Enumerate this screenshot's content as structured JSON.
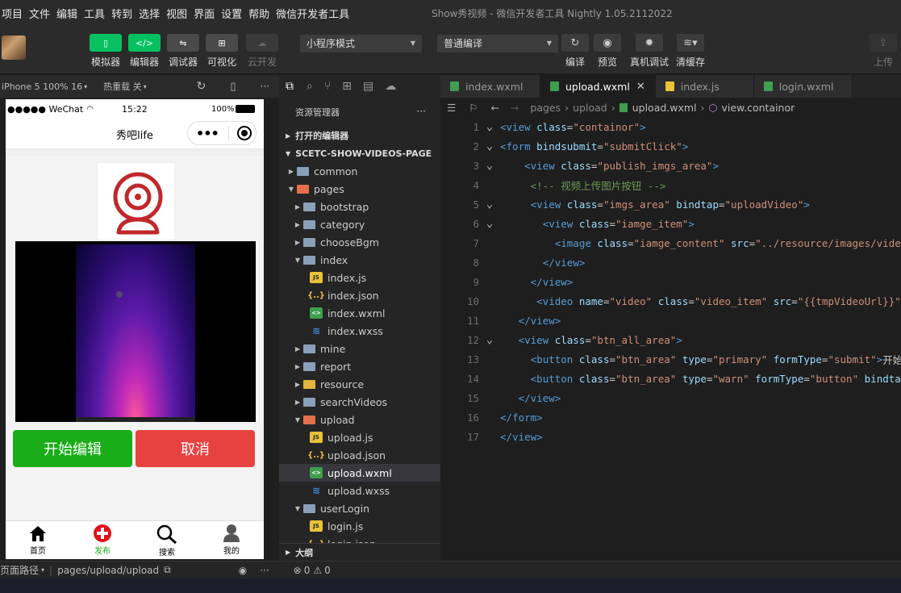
{
  "menu": [
    "项目",
    "文件",
    "编辑",
    "工具",
    "转到",
    "选择",
    "视图",
    "界面",
    "设置",
    "帮助",
    "微信开发者工具"
  ],
  "window_title": "Show秀视频 - 微信开发者工具 Nightly 1.05.2112022",
  "toolbar": {
    "simulator": "模拟器",
    "editor": "编辑器",
    "debugger": "调试器",
    "visual": "可视化",
    "cloud": "云开发",
    "mode_select": "小程序模式",
    "compile_select": "普通编译",
    "compile": "编译",
    "preview": "预览",
    "real_debug": "真机调试",
    "clear_cache": "清缓存",
    "upload": "上传"
  },
  "simulator": {
    "device": "iPhone 5 100% 16",
    "hot_reload": "热重载 关",
    "status_carrier": "●●●●● WeChat",
    "status_time": "15:22",
    "status_battery": "100%",
    "nav_title": "秀吧life",
    "btn_start": "开始编辑",
    "btn_cancel": "取消",
    "tabs": [
      "首页",
      "发布",
      "搜索",
      "我的"
    ]
  },
  "explorer": {
    "title": "资源管理器",
    "open_editors": "打开的编辑器",
    "project": "SCETC-SHOW-VIDEOS-PAGE",
    "outline": "大纲",
    "tree": [
      {
        "name": "common",
        "type": "folder",
        "depth": 1,
        "open": false
      },
      {
        "name": "pages",
        "type": "folder-red",
        "depth": 1,
        "open": true
      },
      {
        "name": "bootstrap",
        "type": "folder",
        "depth": 2,
        "open": false
      },
      {
        "name": "category",
        "type": "folder",
        "depth": 2,
        "open": false
      },
      {
        "name": "chooseBgm",
        "type": "folder",
        "depth": 2,
        "open": false
      },
      {
        "name": "index",
        "type": "folder",
        "depth": 2,
        "open": true
      },
      {
        "name": "index.js",
        "type": "js",
        "depth": 3
      },
      {
        "name": "index.json",
        "type": "json",
        "depth": 3
      },
      {
        "name": "index.wxml",
        "type": "wxml",
        "depth": 3
      },
      {
        "name": "index.wxss",
        "type": "wxss",
        "depth": 3
      },
      {
        "name": "mine",
        "type": "folder",
        "depth": 2,
        "open": false
      },
      {
        "name": "report",
        "type": "folder",
        "depth": 2,
        "open": false
      },
      {
        "name": "resource",
        "type": "folder-yel",
        "depth": 2,
        "open": false
      },
      {
        "name": "searchVideos",
        "type": "folder",
        "depth": 2,
        "open": false
      },
      {
        "name": "upload",
        "type": "folder-red",
        "depth": 2,
        "open": true
      },
      {
        "name": "upload.js",
        "type": "js",
        "depth": 3
      },
      {
        "name": "upload.json",
        "type": "json",
        "depth": 3
      },
      {
        "name": "upload.wxml",
        "type": "wxml",
        "depth": 3,
        "selected": true
      },
      {
        "name": "upload.wxss",
        "type": "wxss",
        "depth": 3
      },
      {
        "name": "userLogin",
        "type": "folder",
        "depth": 2,
        "open": true
      },
      {
        "name": "login.js",
        "type": "js",
        "depth": 3
      },
      {
        "name": "login.json",
        "type": "json",
        "depth": 3
      }
    ]
  },
  "editor": {
    "tabs": [
      {
        "name": "index.wxml",
        "type": "wxml",
        "active": false
      },
      {
        "name": "upload.wxml",
        "type": "wxml",
        "active": true
      },
      {
        "name": "index.js",
        "type": "js",
        "active": false
      },
      {
        "name": "login.wxml",
        "type": "wxml",
        "active": false
      }
    ],
    "breadcrumb": [
      "pages",
      "upload",
      "upload.wxml",
      "view.containor"
    ],
    "lines": [
      [
        [
          "tg",
          "<view "
        ],
        [
          "at",
          "class"
        ],
        [
          "ct",
          "="
        ],
        [
          "st",
          "\"containor\""
        ],
        [
          "tg",
          ">"
        ]
      ],
      [
        [
          "tg",
          "<form "
        ],
        [
          "at",
          "bindsubmit"
        ],
        [
          "ct",
          "="
        ],
        [
          "st",
          "\"submitClick\""
        ],
        [
          "tg",
          ">"
        ]
      ],
      [
        [
          "ct",
          "    "
        ],
        [
          "tg",
          "<view "
        ],
        [
          "at",
          "class"
        ],
        [
          "ct",
          "="
        ],
        [
          "st",
          "\"publish_imgs_area\""
        ],
        [
          "tg",
          ">"
        ]
      ],
      [
        [
          "ct",
          "     "
        ],
        [
          "cm",
          "<!-- 视频上传图片按钮 -->"
        ]
      ],
      [
        [
          "ct",
          "     "
        ],
        [
          "tg",
          "<view "
        ],
        [
          "at",
          "class"
        ],
        [
          "ct",
          "="
        ],
        [
          "st",
          "\"imgs_area\""
        ],
        [
          "ct",
          " "
        ],
        [
          "at",
          "bindtap"
        ],
        [
          "ct",
          "="
        ],
        [
          "st",
          "\"uploadVideo\""
        ],
        [
          "tg",
          ">"
        ]
      ],
      [
        [
          "ct",
          "       "
        ],
        [
          "tg",
          "<view "
        ],
        [
          "at",
          "class"
        ],
        [
          "ct",
          "="
        ],
        [
          "st",
          "\"iamge_item\""
        ],
        [
          "tg",
          ">"
        ]
      ],
      [
        [
          "ct",
          "         "
        ],
        [
          "tg",
          "<image "
        ],
        [
          "at",
          "class"
        ],
        [
          "ct",
          "="
        ],
        [
          "st",
          "\"iamge_content\""
        ],
        [
          "ct",
          " "
        ],
        [
          "at",
          "src"
        ],
        [
          "ct",
          "="
        ],
        [
          "st",
          "\"../resource/images/vide"
        ]
      ],
      [
        [
          "ct",
          "       "
        ],
        [
          "tg",
          "</view>"
        ]
      ],
      [
        [
          "ct",
          "     "
        ],
        [
          "tg",
          "</view>"
        ]
      ],
      [
        [
          "ct",
          "      "
        ],
        [
          "tg",
          "<video "
        ],
        [
          "at",
          "name"
        ],
        [
          "ct",
          "="
        ],
        [
          "st",
          "\"video\""
        ],
        [
          "ct",
          " "
        ],
        [
          "at",
          "class"
        ],
        [
          "ct",
          "="
        ],
        [
          "st",
          "\"video_item\""
        ],
        [
          "ct",
          " "
        ],
        [
          "at",
          "src"
        ],
        [
          "ct",
          "="
        ],
        [
          "st",
          "\"{{tmpVideoUrl}}\""
        ]
      ],
      [
        [
          "ct",
          "   "
        ],
        [
          "tg",
          "</view>"
        ]
      ],
      [
        [
          "ct",
          "   "
        ],
        [
          "tg",
          "<view "
        ],
        [
          "at",
          "class"
        ],
        [
          "ct",
          "="
        ],
        [
          "st",
          "\"btn_all_area\""
        ],
        [
          "tg",
          ">"
        ]
      ],
      [
        [
          "ct",
          "     "
        ],
        [
          "tg",
          "<button "
        ],
        [
          "at",
          "class"
        ],
        [
          "ct",
          "="
        ],
        [
          "st",
          "\"btn_area\""
        ],
        [
          "ct",
          " "
        ],
        [
          "at",
          "type"
        ],
        [
          "ct",
          "="
        ],
        [
          "st",
          "\"primary\""
        ],
        [
          "ct",
          " "
        ],
        [
          "at",
          "formType"
        ],
        [
          "ct",
          "="
        ],
        [
          "st",
          "\"submit\""
        ],
        [
          "tg",
          ">"
        ],
        [
          "ct",
          "开始"
        ]
      ],
      [
        [
          "ct",
          "     "
        ],
        [
          "tg",
          "<button "
        ],
        [
          "at",
          "class"
        ],
        [
          "ct",
          "="
        ],
        [
          "st",
          "\"btn_area\""
        ],
        [
          "ct",
          " "
        ],
        [
          "at",
          "type"
        ],
        [
          "ct",
          "="
        ],
        [
          "st",
          "\"warn\""
        ],
        [
          "ct",
          " "
        ],
        [
          "at",
          "formType"
        ],
        [
          "ct",
          "="
        ],
        [
          "st",
          "\"button\""
        ],
        [
          "ct",
          " "
        ],
        [
          "at",
          "bindta"
        ]
      ],
      [
        [
          "ct",
          "   "
        ],
        [
          "tg",
          "</view>"
        ]
      ],
      [
        [
          "tg",
          "</form>"
        ]
      ],
      [
        [
          "tg",
          "</view>"
        ]
      ]
    ],
    "folds": [
      true,
      true,
      true,
      false,
      true,
      true,
      false,
      false,
      false,
      false,
      false,
      true,
      false,
      false,
      false,
      false,
      false
    ]
  },
  "statusbar": {
    "page_path_label": "页面路径",
    "page_path": "pages/upload/upload",
    "errors": "0",
    "warnings": "0"
  }
}
